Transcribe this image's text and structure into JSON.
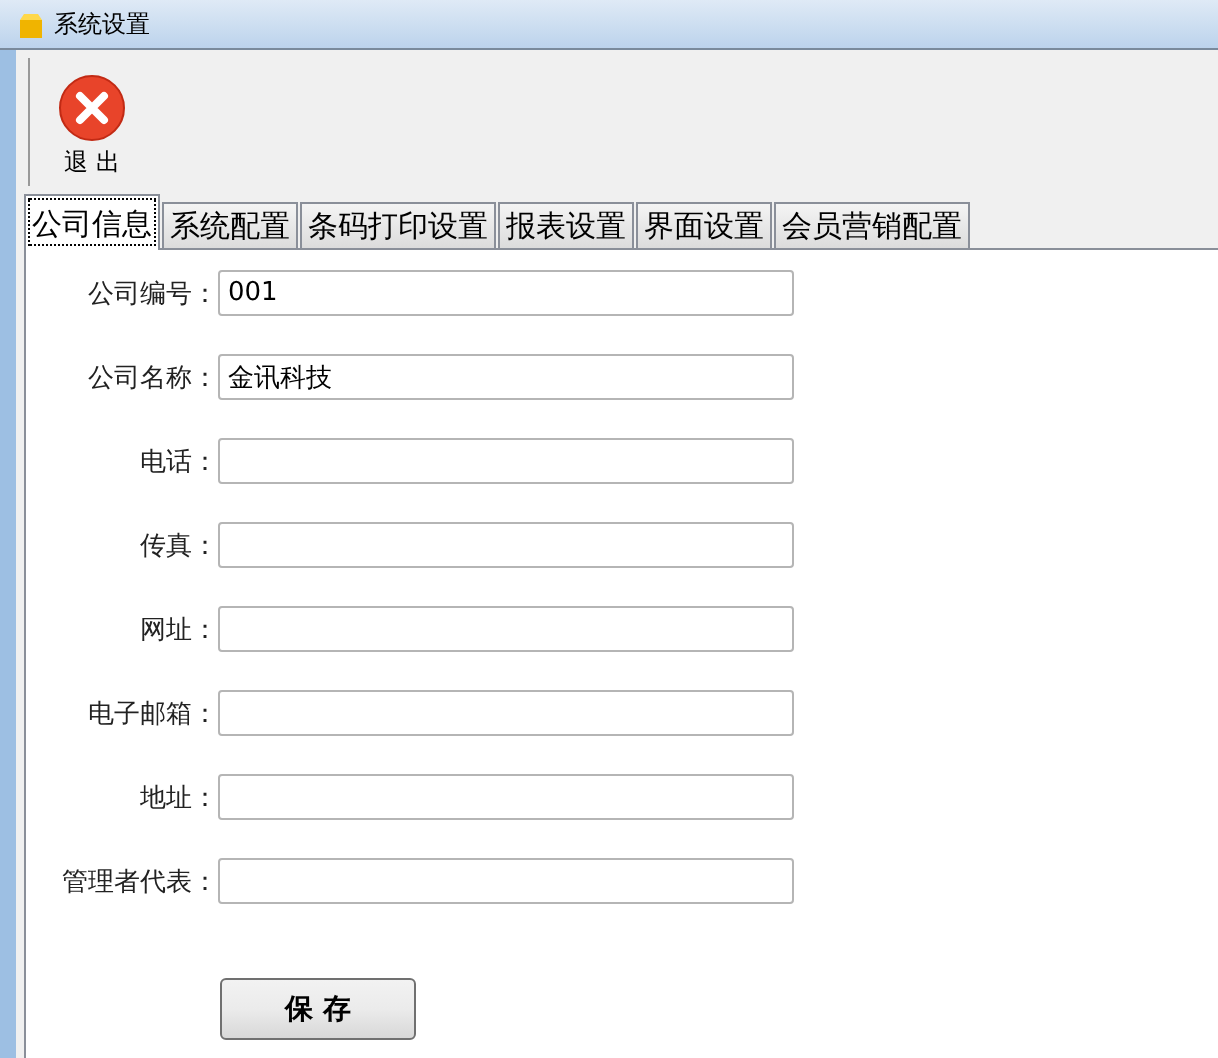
{
  "window": {
    "title": "系统设置"
  },
  "toolbar": [
    {
      "label": "退 出",
      "kind": "exit"
    }
  ],
  "tabs": [
    {
      "label": "公司信息",
      "selected": true
    },
    {
      "label": "系统配置",
      "selected": false
    },
    {
      "label": "条码打印设置",
      "selected": false
    },
    {
      "label": "报表设置",
      "selected": false
    },
    {
      "label": "界面设置",
      "selected": false
    },
    {
      "label": "会员营销配置",
      "selected": false
    }
  ],
  "form": {
    "fields": [
      {
        "label": "公司编号：",
        "value": "001"
      },
      {
        "label": "公司名称：",
        "value": "金讯科技"
      },
      {
        "label": "电话："
      },
      {
        "label": "传真："
      },
      {
        "label": "网址："
      },
      {
        "label": "电子邮箱："
      },
      {
        "label": "地址："
      },
      {
        "label": "管理者代表："
      }
    ],
    "save_button": "保 存"
  }
}
